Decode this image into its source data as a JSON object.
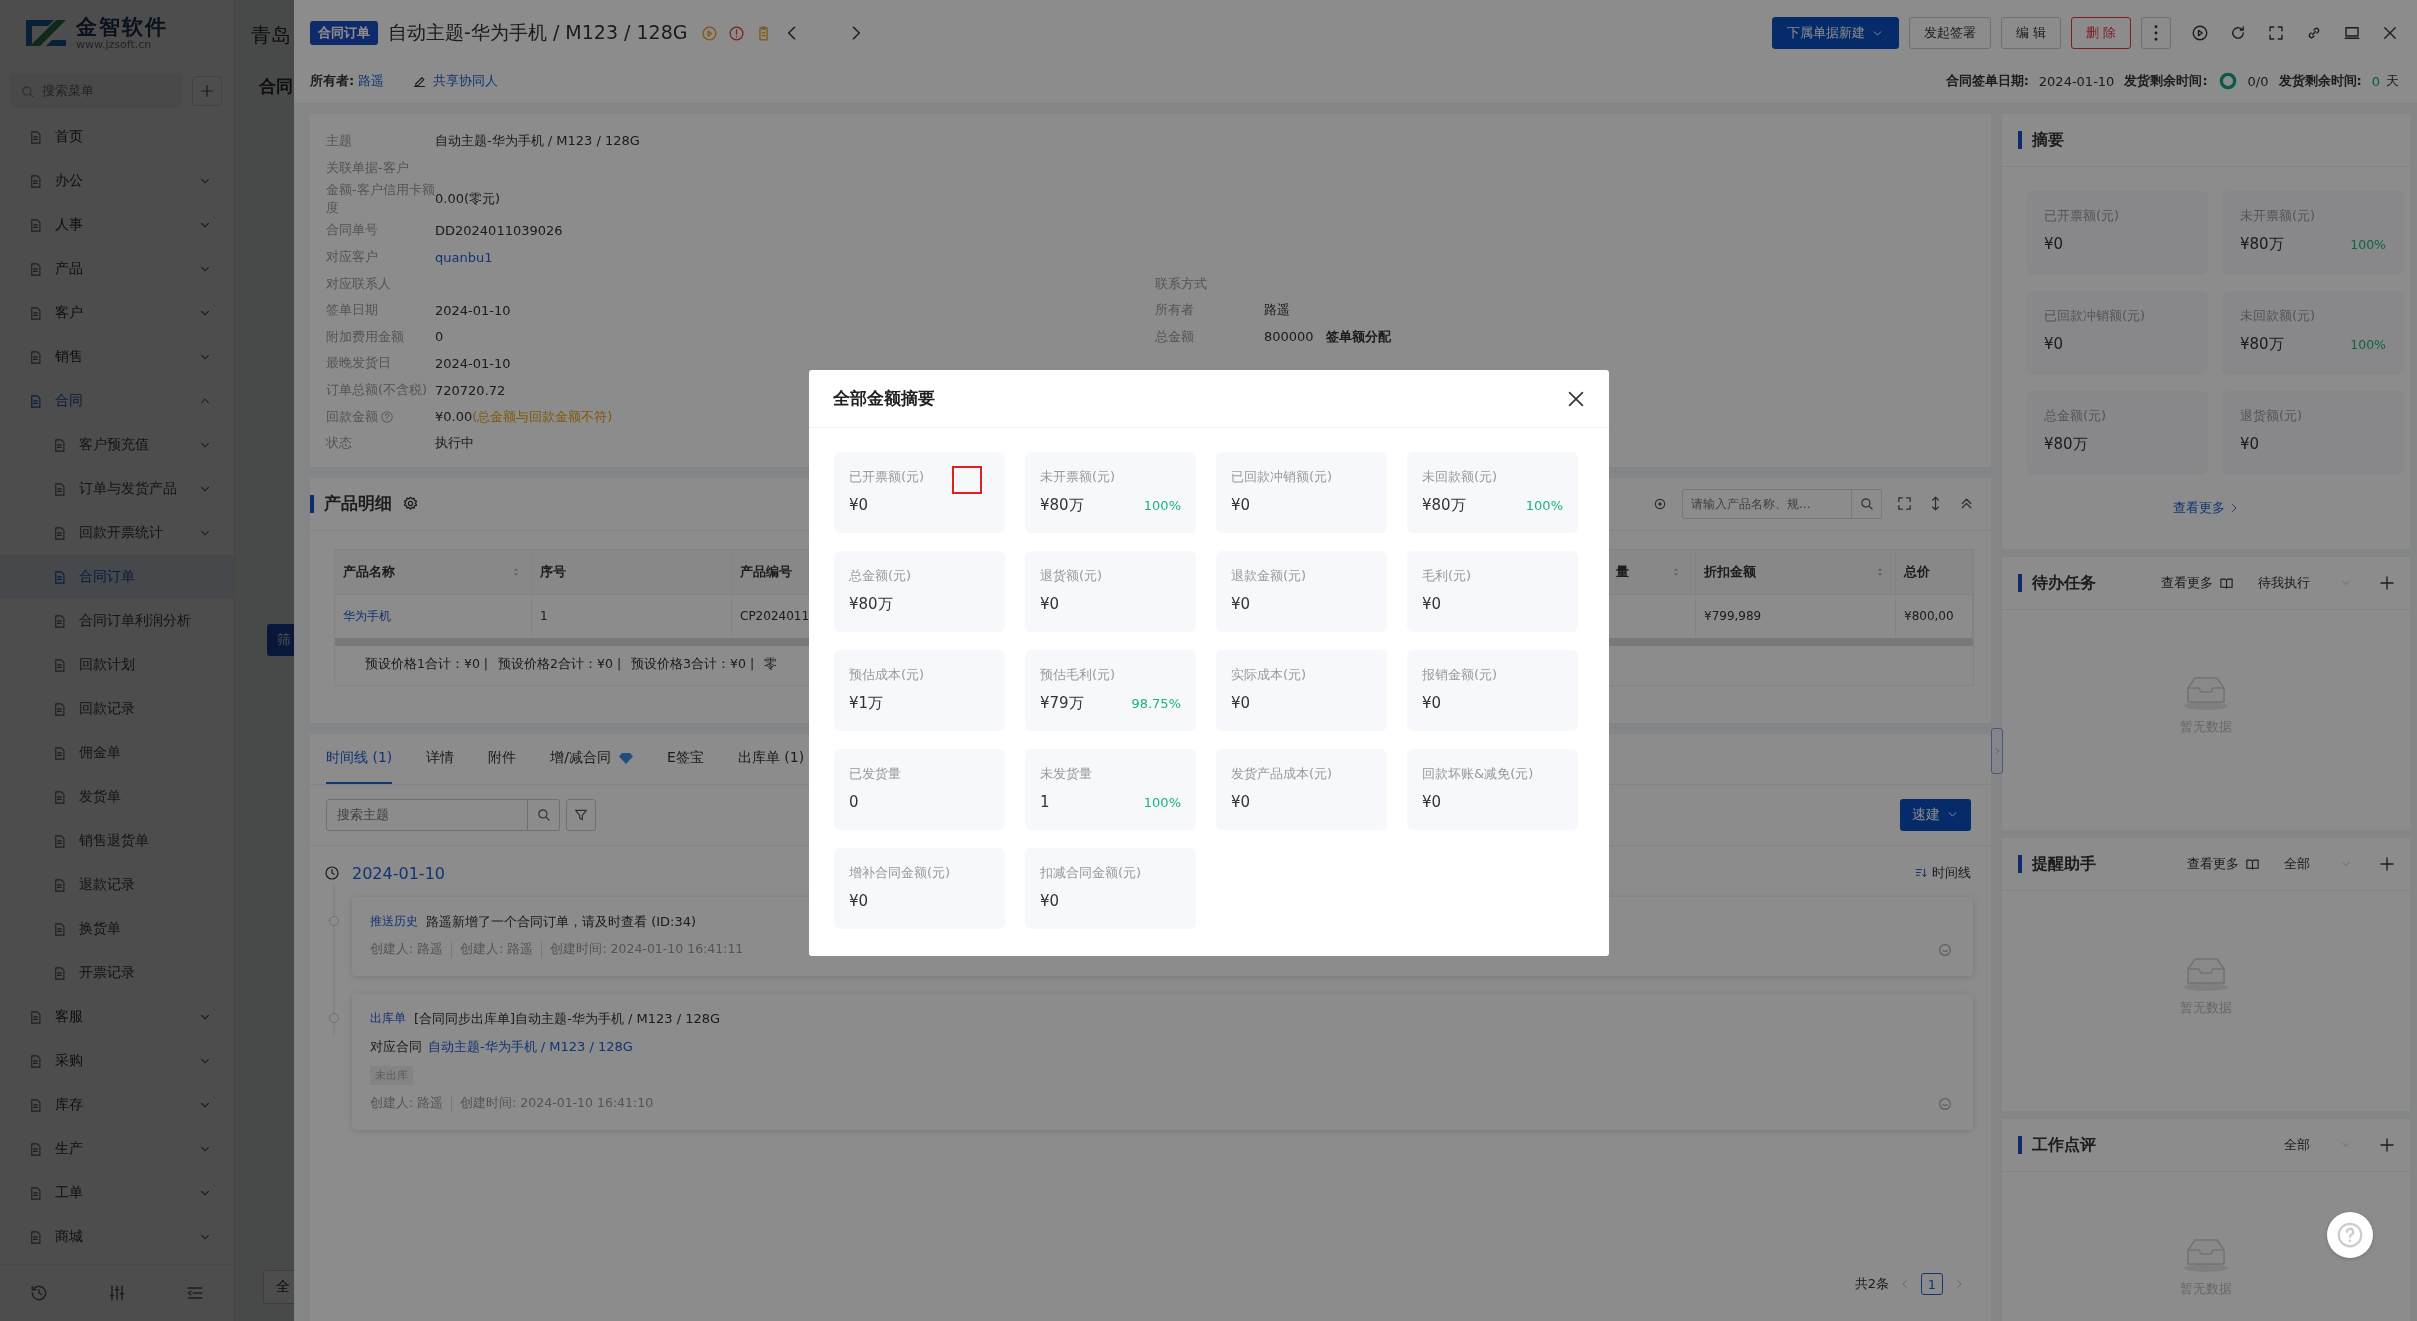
{
  "sidebar": {
    "brand": "金智软件",
    "website": "www.jzsoft.cn",
    "search_placeholder": "搜索菜单",
    "items": [
      {
        "label": "首页",
        "kind": "link",
        "selected": false
      },
      {
        "label": "办公",
        "kind": "group",
        "expanded": false,
        "selected": false
      },
      {
        "label": "人事",
        "kind": "group",
        "expanded": false,
        "selected": false
      },
      {
        "label": "产品",
        "kind": "group",
        "expanded": false,
        "selected": false
      },
      {
        "label": "客户",
        "kind": "group",
        "expanded": false,
        "selected": false
      },
      {
        "label": "销售",
        "kind": "group",
        "expanded": false,
        "selected": false
      },
      {
        "label": "合同",
        "kind": "group",
        "expanded": true,
        "selected": true,
        "children": [
          {
            "label": "客户预充值",
            "kind": "group",
            "expanded": false,
            "selected": false
          },
          {
            "label": "订单与发货产品",
            "kind": "group",
            "expanded": false,
            "selected": false
          },
          {
            "label": "回款开票统计",
            "kind": "group",
            "expanded": false,
            "selected": false
          },
          {
            "label": "合同订单",
            "kind": "link",
            "selected": true
          },
          {
            "label": "合同订单利润分析",
            "kind": "link",
            "selected": false
          },
          {
            "label": "回款计划",
            "kind": "link",
            "selected": false
          },
          {
            "label": "回款记录",
            "kind": "link",
            "selected": false
          },
          {
            "label": "佣金单",
            "kind": "link",
            "selected": false
          },
          {
            "label": "发货单",
            "kind": "link",
            "selected": false
          },
          {
            "label": "销售退货单",
            "kind": "link",
            "selected": false
          },
          {
            "label": "退款记录",
            "kind": "link",
            "selected": false
          },
          {
            "label": "换货单",
            "kind": "link",
            "selected": false
          },
          {
            "label": "开票记录",
            "kind": "link",
            "selected": false
          }
        ]
      },
      {
        "label": "客服",
        "kind": "group",
        "expanded": false,
        "selected": false
      },
      {
        "label": "采购",
        "kind": "group",
        "expanded": false,
        "selected": false
      },
      {
        "label": "库存",
        "kind": "group",
        "expanded": false,
        "selected": false
      },
      {
        "label": "生产",
        "kind": "group",
        "expanded": false,
        "selected": false
      },
      {
        "label": "工单",
        "kind": "group",
        "expanded": false,
        "selected": false
      },
      {
        "label": "商城",
        "kind": "group",
        "expanded": false,
        "selected": false
      }
    ]
  },
  "background_page": {
    "title": "青岛",
    "subtitle": "合同",
    "buttons": [
      "筛",
      "全"
    ]
  },
  "header": {
    "tag": "合同订单",
    "title": "自动主题-华为手机 / M123 / 128G",
    "owner_label": "所有者:",
    "owner": "路遥",
    "share": "共享协同人",
    "buttons": [
      {
        "label": "下属单据新建",
        "kind": "primary"
      },
      {
        "label": "发起签署",
        "kind": "default"
      },
      {
        "label": "编 辑",
        "kind": "default"
      },
      {
        "label": "删 除",
        "kind": "danger"
      }
    ],
    "sign_date_label": "合同签单日期:",
    "sign_date": "2024-01-10",
    "remain_label": "发货剩余时间:",
    "ship_progress": "0/0",
    "remain_days_label": "发货剩余时间:",
    "remain_days": "0",
    "days_unit": "天"
  },
  "details": {
    "rows": [
      {
        "cells": [
          {
            "label": "主题",
            "value": "自动主题-华为手机 / M123 / 128G",
            "kind": "text"
          }
        ]
      },
      {
        "cells": [
          {
            "label": "关联单据-客户"
          }
        ]
      },
      {
        "cells": [
          {
            "label": "金额-客户信用卡额度",
            "value": "0.00(零元)",
            "kind": "text"
          }
        ]
      },
      {
        "cells": [
          {
            "label": "合同单号",
            "value": "DD2024011039026",
            "kind": "text"
          }
        ]
      },
      {
        "cells": [
          {
            "label": "对应客户",
            "value": "quanbu1",
            "kind": "link"
          }
        ]
      },
      {
        "cells": [
          {
            "label": "对应联系人"
          },
          {
            "label": "联系方式"
          }
        ]
      },
      {
        "cells": [
          {
            "label": "签单日期",
            "value": "2024-01-10",
            "kind": "text"
          },
          {
            "label": "所有者",
            "value": "路遥",
            "kind": "text"
          }
        ]
      },
      {
        "cells": [
          {
            "label": "附加费用金额",
            "value": "0",
            "kind": "text"
          },
          {
            "label": "总金额",
            "value": "800000",
            "kind": "text",
            "action": "签单额分配"
          }
        ]
      },
      {
        "cells": [
          {
            "label": "最晚发货日",
            "value": "2024-01-10",
            "kind": "text"
          }
        ]
      },
      {
        "cells": [
          {
            "label": "订单总额(不含税)",
            "value": "720720.72",
            "kind": "text"
          }
        ]
      },
      {
        "cells": [
          {
            "label": "回款金额",
            "help": true,
            "value": "¥0.00",
            "kind": "text",
            "warning": "(总金额与回款金额不符)"
          }
        ]
      },
      {
        "cells": [
          {
            "label": "状态",
            "value": "执行中",
            "kind": "text"
          }
        ]
      }
    ]
  },
  "products": {
    "title": "产品明细",
    "search_placeholder": "请输入产品名称、规...",
    "columns": [
      {
        "label": "产品名称",
        "sortable": true
      },
      {
        "label": "序号",
        "sortable": false
      },
      {
        "label": "产品编号",
        "sortable": false
      },
      {
        "label": "量",
        "sortable": true
      },
      {
        "label": "折扣金额",
        "sortable": true
      },
      {
        "label": "总价",
        "sortable": false
      }
    ],
    "rows": [
      {
        "product": "华为手机",
        "index": "1",
        "code": "CP2024011",
        "discount": "¥799,989",
        "total": "¥800,00"
      }
    ],
    "totals": [
      "预设价格1合计：¥0 |",
      "预设价格2合计：¥0 |",
      "预设价格3合计：¥0 |",
      "零"
    ]
  },
  "activity": {
    "tabs": [
      {
        "label": "时间线 (1)",
        "selected": true,
        "vip": false
      },
      {
        "label": "详情",
        "selected": false,
        "vip": false
      },
      {
        "label": "附件",
        "selected": false,
        "vip": false
      },
      {
        "label": "增/减合同",
        "selected": false,
        "vip": true
      },
      {
        "label": "E签宝",
        "selected": false,
        "vip": false
      },
      {
        "label": "出库单 (1)",
        "selected": false,
        "vip": false
      }
    ],
    "search_placeholder": "搜索主题",
    "quick_create": "速建",
    "date": "2024-01-10",
    "sort_label": "时间线",
    "entries": [
      {
        "tag": "推送历史",
        "text": "路遥新增了一个合同订单，请及时查看 (ID:34)",
        "meta": [
          "创建人: 路遥",
          "创建人: 路遥",
          "创建时间: 2024-01-10 16:41:11"
        ]
      },
      {
        "tag": "出库单",
        "text": "[合同同步出库单]自动主题-华为手机 / M123 / 128G",
        "link_label": "对应合同",
        "link": "自动主题-华为手机 / M123 / 128G",
        "status": "未出库",
        "meta": [
          "创建人: 路遥",
          "创建时间: 2024-01-10 16:41:10"
        ]
      }
    ],
    "total": "共2条",
    "pages": [
      {
        "label": "1",
        "selected": true
      }
    ]
  },
  "summary": {
    "title": "摘要",
    "more": "查看更多",
    "cards": [
      {
        "label": "已开票额(元)",
        "value": "¥0"
      },
      {
        "label": "未开票额(元)",
        "value": "¥80万",
        "percent": "100%"
      },
      {
        "label": "已回款冲销额(元)",
        "value": "¥0"
      },
      {
        "label": "未回款额(元)",
        "value": "¥80万",
        "percent": "100%"
      },
      {
        "label": "总金额(元)",
        "value": "¥80万"
      },
      {
        "label": "退货额(元)",
        "value": "¥0"
      }
    ]
  },
  "widgets": [
    {
      "title": "待办任务",
      "more": "查看更多",
      "filter": "待我执行",
      "empty": "暂无数据"
    },
    {
      "title": "提醒助手",
      "more": "查看更多",
      "filter": "全部",
      "empty": "暂无数据"
    },
    {
      "title": "工作点评",
      "filter": "全部",
      "empty": "暂无数据"
    }
  ],
  "modal": {
    "title": "全部金额摘要",
    "cards": [
      {
        "label": "已开票额(元)",
        "value": "¥0",
        "highlighted": true
      },
      {
        "label": "未开票额(元)",
        "value": "¥80万",
        "percent": "100%",
        "highlighted": false
      },
      {
        "label": "已回款冲销额(元)",
        "value": "¥0",
        "highlighted": false
      },
      {
        "label": "未回款额(元)",
        "value": "¥80万",
        "percent": "100%",
        "highlighted": false
      },
      {
        "label": "总金额(元)",
        "value": "¥80万",
        "highlighted": false
      },
      {
        "label": "退货额(元)",
        "value": "¥0",
        "highlighted": false
      },
      {
        "label": "退款金额(元)",
        "value": "¥0",
        "highlighted": false
      },
      {
        "label": "毛利(元)",
        "value": "¥0",
        "highlighted": false
      },
      {
        "label": "预估成本(元)",
        "value": "¥1万",
        "highlighted": false
      },
      {
        "label": "预估毛利(元)",
        "value": "¥79万",
        "percent": "98.75%",
        "highlighted": false
      },
      {
        "label": "实际成本(元)",
        "value": "¥0",
        "highlighted": false
      },
      {
        "label": "报销金额(元)",
        "value": "¥0",
        "highlighted": false
      },
      {
        "label": "已发货量",
        "value": "0",
        "highlighted": false
      },
      {
        "label": "未发货量",
        "value": "1",
        "percent": "100%",
        "highlighted": false
      },
      {
        "label": "发货产品成本(元)",
        "value": "¥0",
        "highlighted": false
      },
      {
        "label": "回款坏账&减免(元)",
        "value": "¥0",
        "highlighted": false
      },
      {
        "label": "增补合同金额(元)",
        "value": "¥0",
        "highlighted": false
      },
      {
        "label": "扣减合同金额(元)",
        "value": "¥0",
        "highlighted": false
      }
    ]
  }
}
